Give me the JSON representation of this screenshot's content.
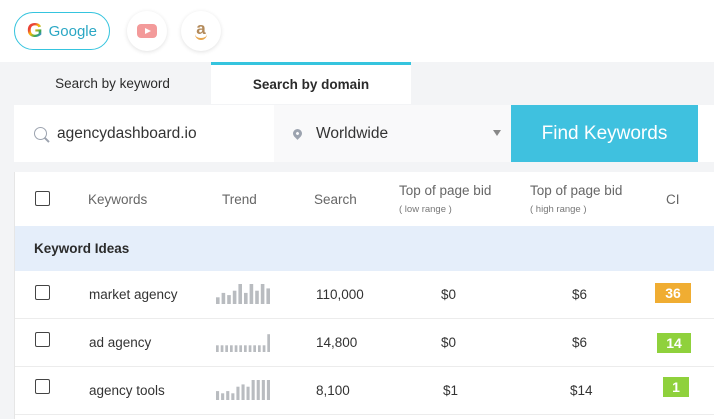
{
  "sources": {
    "google": {
      "label": "Google",
      "icon": "google-g-icon",
      "selected": true
    },
    "youtube": {
      "icon": "youtube-icon"
    },
    "amazon": {
      "icon": "amazon-icon",
      "letter": "a"
    }
  },
  "tabs": [
    {
      "label": "Search by keyword",
      "active": false
    },
    {
      "label": "Search by domain",
      "active": true
    }
  ],
  "search": {
    "keyword_value": "agencydashboard.io",
    "location_value": "Worldwide",
    "find_button_label": "Find Keywords"
  },
  "table": {
    "headers": {
      "keywords": "Keywords",
      "trend": "Trend",
      "search": "Search",
      "bid_low": "Top of page bid",
      "bid_low_sub": "( low range )",
      "bid_high": "Top of page bid",
      "bid_high_sub": "( high range )",
      "ci": "CI"
    },
    "section_label": "Keyword Ideas",
    "rows": [
      {
        "keyword": "market agency",
        "search": "110,000",
        "bid_low": "$0",
        "bid_high": "$6",
        "ci": "36",
        "ci_color": "#f0ad32",
        "trend": [
          3,
          5,
          4,
          6,
          9,
          5,
          9,
          6,
          9,
          7
        ]
      },
      {
        "keyword": "ad agency",
        "search": "14,800",
        "bid_low": "$0",
        "bid_high": "$6",
        "ci": "14",
        "ci_color": "#8fd13c",
        "trend": [
          3,
          3,
          3,
          3,
          3,
          3,
          3,
          3,
          3,
          3,
          3,
          8
        ]
      },
      {
        "keyword": "agency tools",
        "search": "8,100",
        "bid_low": "$1",
        "bid_high": "$14",
        "ci": "1",
        "ci_color": "#8fd13c",
        "trend": [
          4,
          3,
          4,
          3,
          6,
          7,
          6,
          9,
          9,
          9,
          9
        ]
      }
    ]
  },
  "colors": {
    "accent": "#3fc1df",
    "section_bg": "#e5eefa"
  }
}
